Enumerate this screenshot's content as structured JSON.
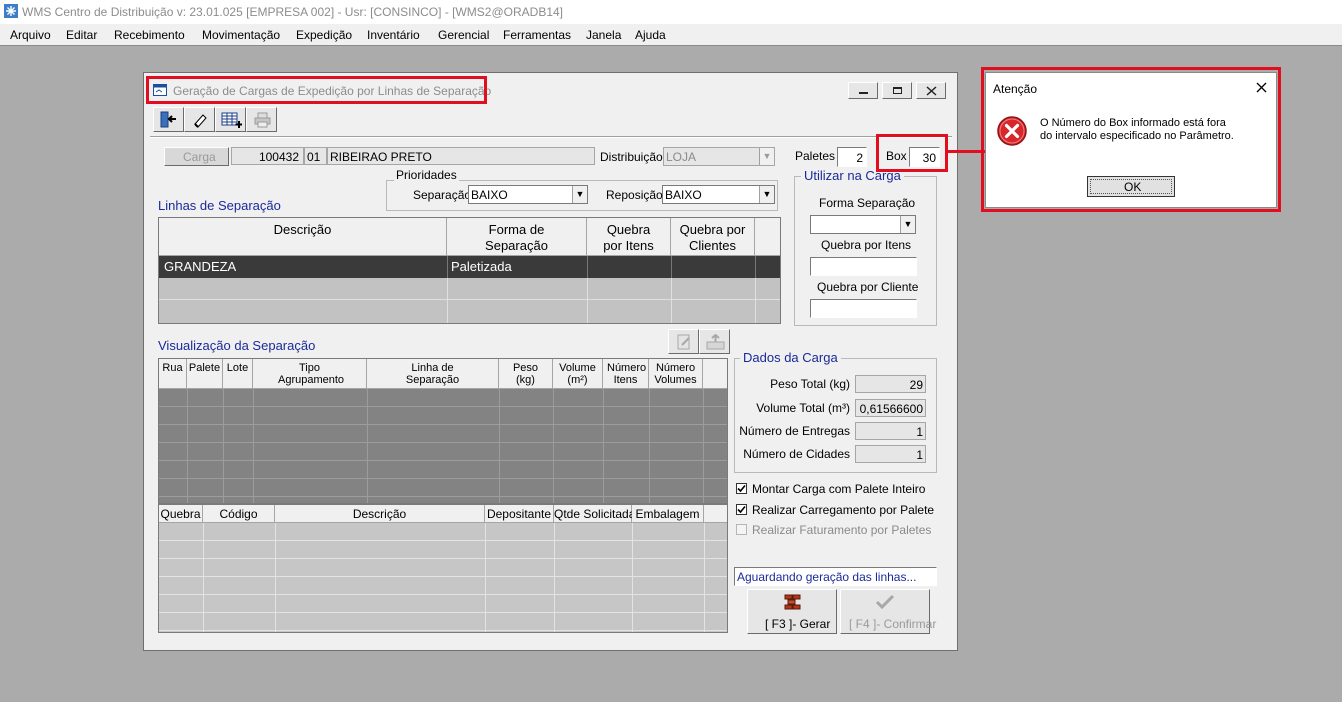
{
  "app": {
    "title": "WMS Centro de Distribuição  v: 23.01.025   [EMPRESA 002] - Usr: [CONSINCO] - [WMS2@ORADB14]"
  },
  "menu": [
    "Arquivo",
    "Editar",
    "Recebimento",
    "Movimentação",
    "Expedição",
    "Inventário",
    "Gerencial",
    "Ferramentas",
    "Janela",
    "Ajuda"
  ],
  "window": {
    "title": "Geração de Cargas de Expedição por Linhas de Separação"
  },
  "carga": {
    "button": "Carga",
    "numero": "100432",
    "codigo": "01",
    "nome": "RIBEIRAO PRETO",
    "distribuicao_label": "Distribuição",
    "distribuicao_value": "LOJA",
    "paletes_label": "Paletes",
    "paletes_value": "2",
    "box_label": "Box",
    "box_value": "30"
  },
  "prioridades": {
    "title": "Prioridades",
    "separacao_label": "Separação",
    "separacao_value": "BAIXO",
    "reposicao_label": "Reposição",
    "reposicao_value": "BAIXO"
  },
  "linhas": {
    "title": "Linhas de Separação",
    "headers": [
      "Descrição",
      "Forma de Separação",
      "Quebra por Itens",
      "Quebra por Clientes"
    ],
    "rows": [
      [
        "GRANDEZA",
        "Paletizada",
        "",
        ""
      ]
    ]
  },
  "utilizar": {
    "title": "Utilizar na Carga",
    "forma_label": "Forma Separação",
    "quebra_itens_label": "Quebra por Itens",
    "quebra_cliente_label": "Quebra por Cliente"
  },
  "visualizacao": {
    "title": "Visualização da Separação",
    "headers": [
      "Rua",
      "Palete",
      "Lote",
      "Tipo Agrupamento",
      "Linha de Separação",
      "Peso (kg)",
      "Volume (m²)",
      "Número Itens",
      "Número Volumes"
    ]
  },
  "detalhe": {
    "headers": [
      "Quebra",
      "Código",
      "Descrição",
      "Depositante",
      "Qtde Solicitada",
      "Embalagem"
    ]
  },
  "dados": {
    "title": "Dados da Carga",
    "rows": [
      {
        "label": "Peso Total (kg)",
        "value": "29"
      },
      {
        "label": "Volume Total (m³)",
        "value": "0,61566600"
      },
      {
        "label": "Número de Entregas",
        "value": "1"
      },
      {
        "label": "Número de Cidades",
        "value": "1"
      }
    ]
  },
  "options": {
    "montar": "Montar Carga com Palete Inteiro",
    "realizar_carreg": "Realizar Carregamento por Palete",
    "realizar_fat": "Realizar Faturamento por Paletes"
  },
  "status": "Aguardando geração das linhas...",
  "buttons": {
    "gerar": "[ F3 ]- Gerar",
    "confirmar": "[ F4 ]- Confirmar"
  },
  "dialog": {
    "title": "Atenção",
    "line1": "O Número do Box informado está fora",
    "line2": "do intervalo especificado no Parâmetro.",
    "ok": "OK"
  }
}
